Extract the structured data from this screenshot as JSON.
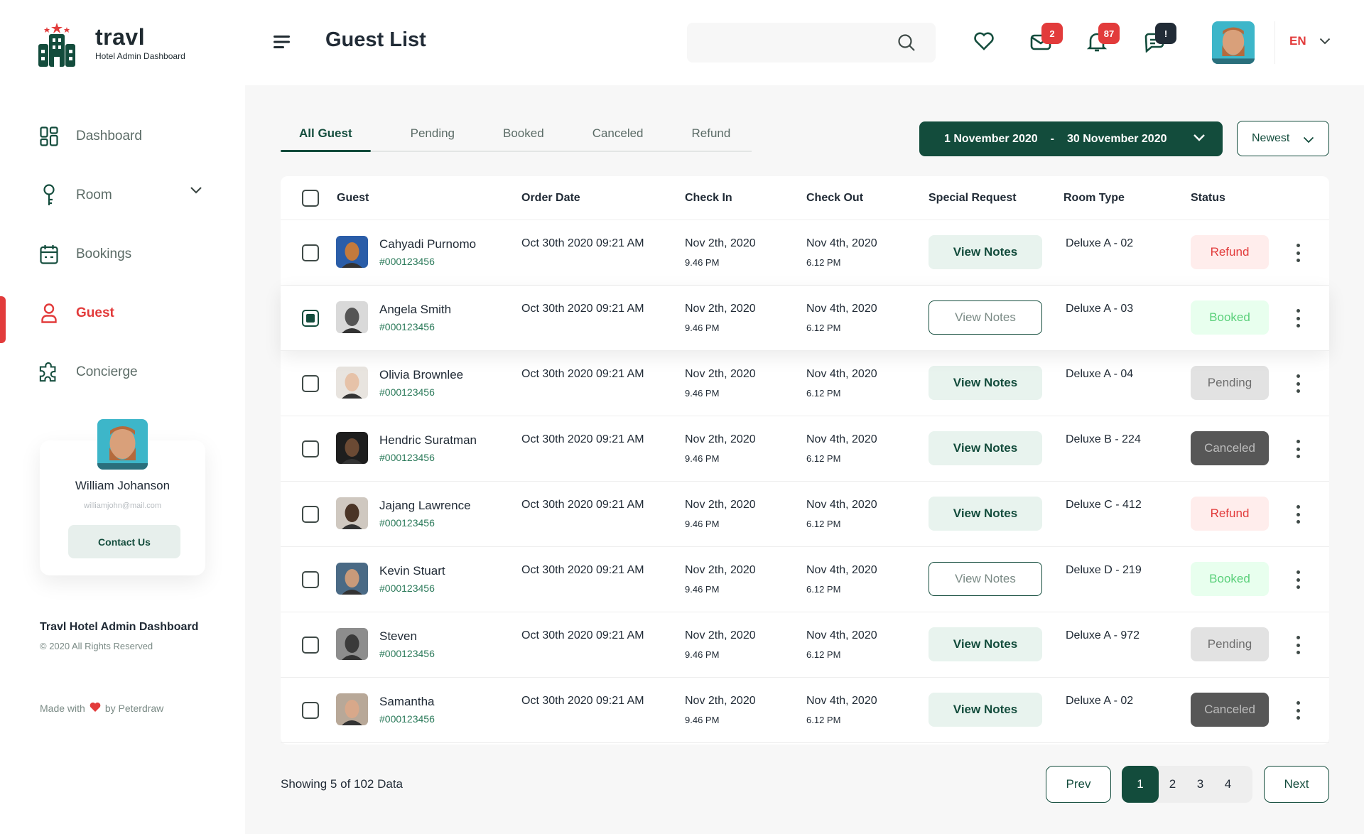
{
  "brand": {
    "name": "travl",
    "subtitle": "Hotel Admin Dashboard"
  },
  "sidebar": {
    "items": [
      {
        "label": "Dashboard",
        "icon": "dashboard-icon"
      },
      {
        "label": "Room",
        "icon": "key-icon"
      },
      {
        "label": "Bookings",
        "icon": "calendar-icon"
      },
      {
        "label": "Guest",
        "icon": "user-icon"
      },
      {
        "label": "Concierge",
        "icon": "puzzle-icon"
      }
    ],
    "active": "Guest",
    "profile": {
      "name": "William Johanson",
      "email": "williamjohn@mail.com",
      "button": "Contact Us"
    },
    "footer_title": "Travl Hotel Admin Dashboard",
    "footer_copy": "© 2020 All Rights Reserved",
    "made_with": "Made with",
    "made_by": "by Peterdraw"
  },
  "header": {
    "title": "Guest List",
    "search_placeholder": "",
    "badges": {
      "mail": "2",
      "bell": "87",
      "chat": "!"
    },
    "language": "EN"
  },
  "tabs": [
    "All Guest",
    "Pending",
    "Booked",
    "Canceled",
    "Refund"
  ],
  "filters": {
    "date_from": "1 November 2020",
    "date_sep": "-",
    "date_to": "30 November 2020",
    "sort": "Newest"
  },
  "table": {
    "headers": [
      "Guest",
      "Order Date",
      "Check In",
      "Check Out",
      "Special Request",
      "Room Type",
      "Status"
    ],
    "rows": [
      {
        "name": "Cahyadi Purnomo",
        "id": "#000123456",
        "order_date": "Oct 30th 2020 09:21 AM",
        "check_in_date": "Nov 2th, 2020",
        "check_in_time": "9.46 PM",
        "check_out_date": "Nov 4th, 2020",
        "check_out_time": "6.12 PM",
        "notes": "View Notes",
        "room": "Deluxe A - 02",
        "status": "Refund"
      },
      {
        "name": "Angela Smith",
        "id": "#000123456",
        "order_date": "Oct 30th 2020 09:21 AM",
        "check_in_date": "Nov 2th, 2020",
        "check_in_time": "9.46 PM",
        "check_out_date": "Nov 4th, 2020",
        "check_out_time": "6.12 PM",
        "notes": "View Notes",
        "room": "Deluxe A - 03",
        "status": "Booked"
      },
      {
        "name": "Olivia Brownlee",
        "id": "#000123456",
        "order_date": "Oct 30th 2020 09:21 AM",
        "check_in_date": "Nov 2th, 2020",
        "check_in_time": "9.46 PM",
        "check_out_date": "Nov 4th, 2020",
        "check_out_time": "6.12 PM",
        "notes": "View Notes",
        "room": "Deluxe A - 04",
        "status": "Pending"
      },
      {
        "name": "Hendric Suratman",
        "id": "#000123456",
        "order_date": "Oct 30th 2020 09:21 AM",
        "check_in_date": "Nov 2th, 2020",
        "check_in_time": "9.46 PM",
        "check_out_date": "Nov 4th, 2020",
        "check_out_time": "6.12 PM",
        "notes": "View Notes",
        "room": "Deluxe B - 224",
        "status": "Canceled"
      },
      {
        "name": "Jajang Lawrence",
        "id": "#000123456",
        "order_date": "Oct 30th 2020 09:21 AM",
        "check_in_date": "Nov 2th, 2020",
        "check_in_time": "9.46 PM",
        "check_out_date": "Nov 4th, 2020",
        "check_out_time": "6.12 PM",
        "notes": "View Notes",
        "room": "Deluxe C - 412",
        "status": "Refund"
      },
      {
        "name": "Kevin Stuart",
        "id": "#000123456",
        "order_date": "Oct 30th 2020 09:21 AM",
        "check_in_date": "Nov 2th, 2020",
        "check_in_time": "9.46 PM",
        "check_out_date": "Nov 4th, 2020",
        "check_out_time": "6.12 PM",
        "notes": "View Notes",
        "room": "Deluxe D - 219",
        "status": "Booked"
      },
      {
        "name": "Steven",
        "id": "#000123456",
        "order_date": "Oct 30th 2020 09:21 AM",
        "check_in_date": "Nov 2th, 2020",
        "check_in_time": "9.46 PM",
        "check_out_date": "Nov 4th, 2020",
        "check_out_time": "6.12 PM",
        "notes": "View Notes",
        "room": "Deluxe A - 972",
        "status": "Pending"
      },
      {
        "name": "Samantha",
        "id": "#000123456",
        "order_date": "Oct 30th 2020 09:21 AM",
        "check_in_date": "Nov 2th, 2020",
        "check_in_time": "9.46 PM",
        "check_out_date": "Nov 4th, 2020",
        "check_out_time": "6.12 PM",
        "notes": "View Notes",
        "room": "Deluxe A - 02",
        "status": "Canceled"
      }
    ]
  },
  "pagination": {
    "showing": "Showing 5 of 102 Data",
    "prev": "Prev",
    "next": "Next",
    "pages": [
      "1",
      "2",
      "3",
      "4"
    ],
    "current": "1"
  },
  "colors": {
    "primary": "#134c3c",
    "accent_red": "#e23b3b",
    "refund_bg": "#ffedec",
    "booked_bg": "#e8ffee",
    "pending_bg": "#e2e2e2",
    "canceled_bg": "#575757"
  }
}
